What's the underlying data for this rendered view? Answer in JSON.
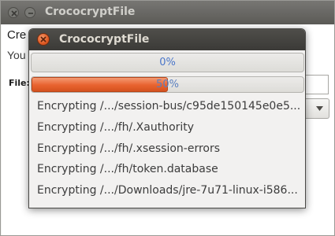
{
  "background_window": {
    "title": "CrococryptFile",
    "heading": "Cre",
    "subtext": "You",
    "file_label": "File:"
  },
  "dialog": {
    "title": "CrococryptFile",
    "overall_progress": {
      "text": "0%",
      "fraction": 0.0
    },
    "file_progress": {
      "text": "50%",
      "fraction": 0.5
    },
    "log": [
      "Encrypting /.../session-bus/c95de150145e0e5...",
      "Encrypting /.../fh/.Xauthority",
      "Encrypting /.../fh/.xsession-errors",
      "Encrypting /.../fh/token.database",
      "Encrypting /.../Downloads/jre-7u71-linux-i586..."
    ]
  },
  "colors": {
    "accent": "#e8622f",
    "progress_text": "#4a76c9",
    "titlebar_dark": "#3b3a37"
  }
}
